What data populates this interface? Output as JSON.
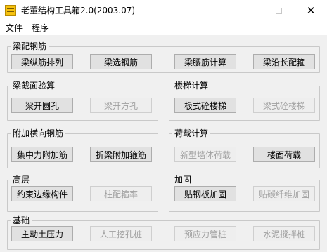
{
  "window": {
    "title": "老董结构工具箱2.0(2003.07)",
    "controls": {
      "minimize": "",
      "maximize": "",
      "close": "✕"
    }
  },
  "menu": [
    "文件",
    "程序"
  ],
  "groups": {
    "beam_rebar": {
      "label": "梁配钢筋",
      "buttons": [
        {
          "label": "梁纵筋排列",
          "enabled": true
        },
        {
          "label": "梁选钢筋",
          "enabled": true
        },
        {
          "label": "梁腰筋计算",
          "enabled": true
        },
        {
          "label": "梁沿长配箍",
          "enabled": true
        }
      ]
    },
    "beam_section": {
      "label": "梁截面验算",
      "buttons": [
        {
          "label": "梁开圆孔",
          "enabled": true
        },
        {
          "label": "梁开方孔",
          "enabled": false
        }
      ]
    },
    "stair": {
      "label": "楼梯计算",
      "buttons": [
        {
          "label": "板式砼楼梯",
          "enabled": true
        },
        {
          "label": "梁式砼楼梯",
          "enabled": false
        }
      ]
    },
    "extra_rebar": {
      "label": "附加横向钢筋",
      "buttons": [
        {
          "label": "集中力附加筋",
          "enabled": true
        },
        {
          "label": "折梁附加箍筋",
          "enabled": true
        }
      ]
    },
    "load": {
      "label": "荷载计算",
      "buttons": [
        {
          "label": "新型墙体荷载",
          "enabled": false
        },
        {
          "label": "楼面荷载",
          "enabled": true
        }
      ]
    },
    "highrise": {
      "label": "高层",
      "buttons": [
        {
          "label": "约束边缘构件",
          "enabled": true
        },
        {
          "label": "柱配箍率",
          "enabled": false
        }
      ]
    },
    "reinforce": {
      "label": "加固",
      "buttons": [
        {
          "label": "贴钢板加固",
          "enabled": true
        },
        {
          "label": "贴碳纤维加固",
          "enabled": false
        }
      ]
    },
    "foundation": {
      "label": "基础",
      "buttons": [
        {
          "label": "主动土压力",
          "enabled": true
        },
        {
          "label": "人工挖孔桩",
          "enabled": false
        },
        {
          "label": "预应力管桩",
          "enabled": false
        },
        {
          "label": "水泥搅拌桩",
          "enabled": false
        }
      ]
    }
  },
  "colors": {
    "client_bg": "#f0f0f0",
    "button_bg": "#e1e1e1",
    "button_border": "#adadad",
    "disabled_text": "#a0a0a0",
    "group_border": "#c9c9c9",
    "icon": "#f6c20f"
  },
  "icons": {
    "app": "toolbox-icon"
  }
}
